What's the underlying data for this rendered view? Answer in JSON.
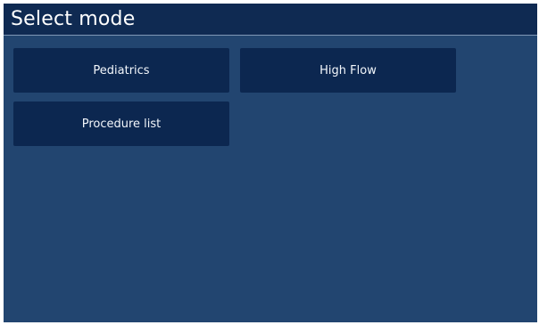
{
  "header": {
    "title": "Select mode"
  },
  "modes": [
    {
      "label": "Pediatrics"
    },
    {
      "label": "High Flow"
    },
    {
      "label": "Procedure list"
    }
  ],
  "colors": {
    "background": "#224570",
    "header": "#0f2a52",
    "button": "#0c2750",
    "text": "#ffffff"
  }
}
